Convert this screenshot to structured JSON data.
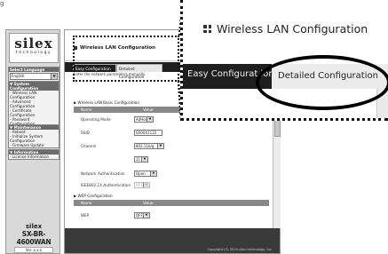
{
  "top_note": "g",
  "sidebar": {
    "logo": "silex",
    "logo_tagline": "technology",
    "lang_header": "Select Language",
    "lang_value": "English",
    "system_header": "▼ System Configuration",
    "system_items": [
      "- Wireless LAN",
      "  Configuration",
      "- Advanced",
      "Configuration",
      "- Certificate",
      "  Configuration",
      "- Password",
      "Configuration"
    ],
    "maint_header": "▼ Maintenance",
    "maint_items": [
      "- Reboot",
      "- Initialize System",
      "  Configuration",
      "- Firmware Update"
    ],
    "info_header": "▼ Information",
    "info_items": [
      "- License Information"
    ],
    "brand": "silex",
    "model": "SX-BR-4600WAN",
    "version": "Ver. x.x.x"
  },
  "main": {
    "title": "Wireless LAN Configuration",
    "tabs": [
      "Easy Configuration",
      "Detailed Configuration"
    ],
    "instructions": "Enter the network parameters manually.",
    "section1": "▶ Wireless LAN Basic Configuration",
    "header_name": "Name",
    "header_value": "Value",
    "rows": {
      "mode_label": "Operating Mode",
      "mode_value": "AdHoc",
      "ssid_label": "SSID",
      "ssid_value": "SX00X1122",
      "channel_label": "Channel",
      "channel_std": "802.11b/g",
      "channel_num": "11",
      "auth_label": "Network Authentication",
      "auth_value": "Open",
      "ieee_label": "IEEE802.1X Authentication",
      "ieee_value": "OFF"
    },
    "section2": "▶ WEP Configuration",
    "wep_label": "WEP",
    "wep_value": "OFF",
    "copyright": "Copyright (C) 2010 silex technology, Inc."
  },
  "zoom": {
    "title": "Wireless LAN Configuration",
    "tab_easy": "Easy Configurat ion",
    "tab_detailed": "Detailed Configuration"
  }
}
